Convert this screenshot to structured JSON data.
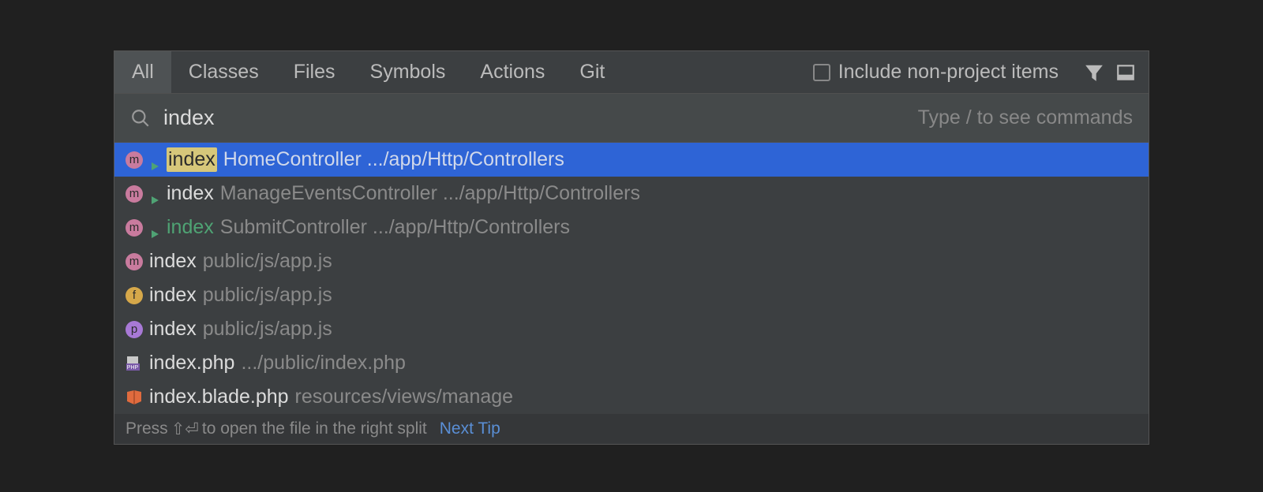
{
  "tabs": [
    {
      "label": "All",
      "active": true
    },
    {
      "label": "Classes",
      "active": false
    },
    {
      "label": "Files",
      "active": false
    },
    {
      "label": "Symbols",
      "active": false
    },
    {
      "label": "Actions",
      "active": false
    },
    {
      "label": "Git",
      "active": false
    }
  ],
  "include_checkbox": {
    "label": "Include non-project items",
    "checked": false
  },
  "search": {
    "value": "index",
    "placeholder": "Type / to see commands"
  },
  "results": [
    {
      "icon": "m",
      "run": true,
      "match": "index",
      "highlight": true,
      "selected": true,
      "location": "HomeController .../app/Http/Controllers"
    },
    {
      "icon": "m",
      "run": true,
      "match": "index",
      "highlight": false,
      "selected": false,
      "location": "ManageEventsController .../app/Http/Controllers"
    },
    {
      "icon": "m",
      "run": true,
      "match": "index",
      "highlight": false,
      "match_green": true,
      "selected": false,
      "location": "SubmitController .../app/Http/Controllers"
    },
    {
      "icon": "m",
      "run": false,
      "match": "index",
      "highlight": false,
      "selected": false,
      "location": "public/js/app.js"
    },
    {
      "icon": "f",
      "run": false,
      "match": "index",
      "highlight": false,
      "selected": false,
      "location": "public/js/app.js"
    },
    {
      "icon": "p",
      "run": false,
      "match": "index",
      "highlight": false,
      "selected": false,
      "location": "public/js/app.js"
    },
    {
      "icon": "php",
      "run": false,
      "match": "index.php",
      "highlight": false,
      "selected": false,
      "location": ".../public/index.php"
    },
    {
      "icon": "blade",
      "run": false,
      "match": "index.blade.php",
      "highlight": false,
      "selected": false,
      "location": "resources/views/manage"
    }
  ],
  "footer": {
    "text_before": "Press",
    "key_symbol": "⇧⏎",
    "text_after": "to open the file in the right split",
    "link": "Next Tip"
  }
}
